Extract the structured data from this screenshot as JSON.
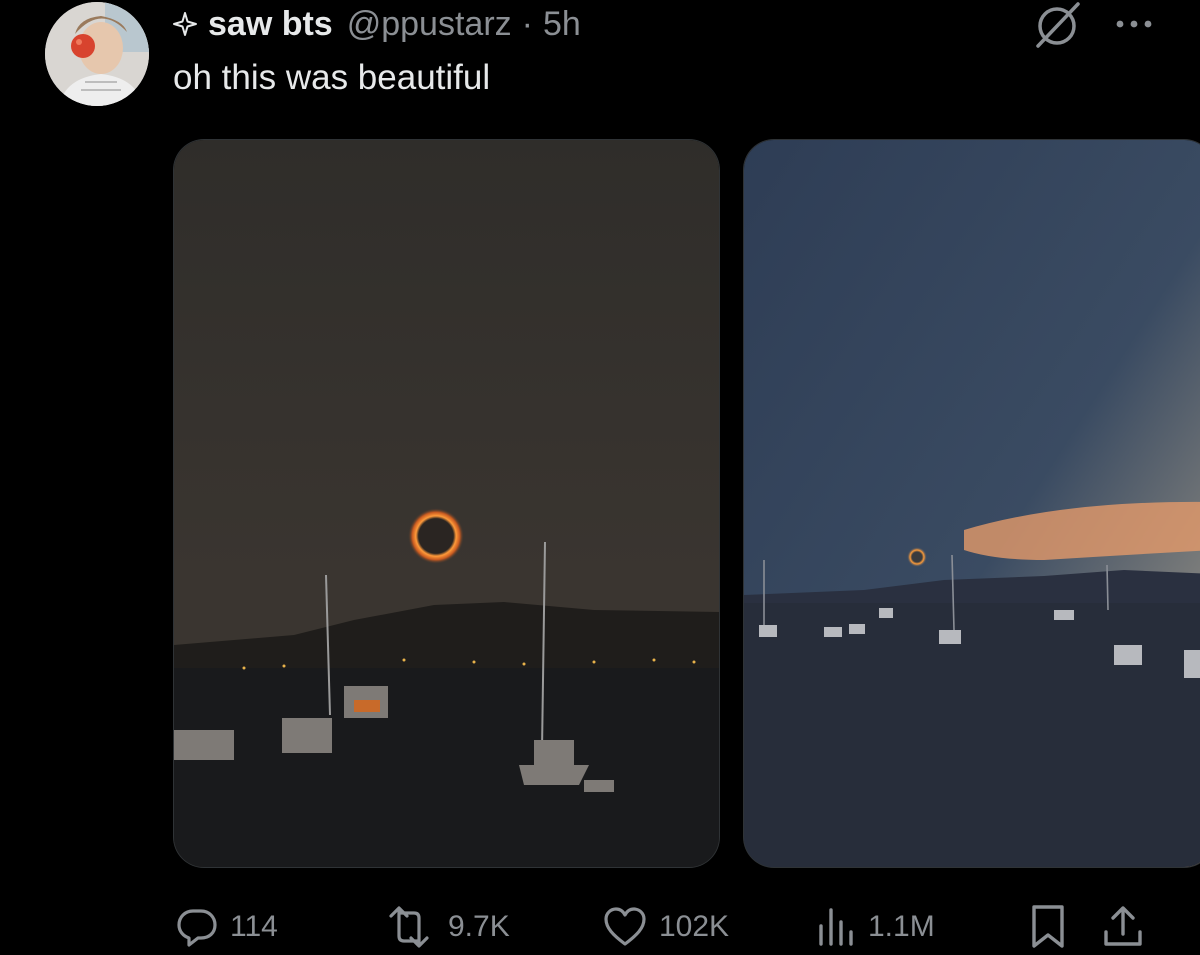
{
  "post": {
    "display_name": "saw bts",
    "handle": "@ppustarz",
    "separator": "·",
    "time": "5h",
    "text": "oh this was beautiful"
  },
  "icons": {
    "verified": "sparkle-icon",
    "grok": "grok-icon",
    "more": "more-icon",
    "reply": "reply-icon",
    "repost": "repost-icon",
    "like": "heart-icon",
    "views": "views-icon",
    "bookmark": "bookmark-icon",
    "share": "share-icon"
  },
  "media": [
    {
      "alt": "eclipse-photo-1"
    },
    {
      "alt": "eclipse-photo-2"
    }
  ],
  "actions": {
    "replies": "114",
    "reposts": "9.7K",
    "likes": "102K",
    "views": "1.1M"
  },
  "colors": {
    "background": "#000000",
    "text": "#e7e9ea",
    "muted": "#8b8f94"
  }
}
